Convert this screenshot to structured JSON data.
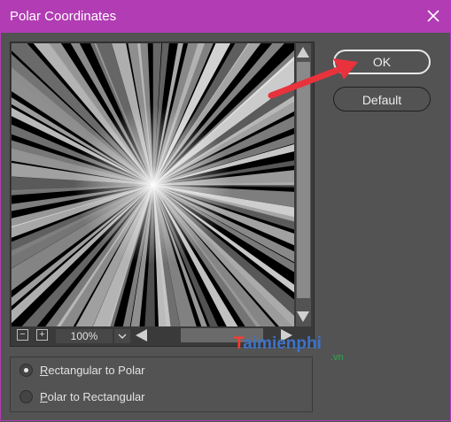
{
  "window": {
    "title": "Polar Coordinates",
    "close_icon": "close-icon",
    "accent_color": "#b23cb4"
  },
  "preview": {
    "zoom_value": "100%",
    "zoom_out_label": "−",
    "zoom_in_label": "+"
  },
  "options": {
    "items": [
      {
        "accel": "R",
        "rest": "ectangular to Polar",
        "checked": true
      },
      {
        "accel": "P",
        "rest": "olar to Rectangular",
        "checked": false
      }
    ]
  },
  "buttons": {
    "ok_label": "OK",
    "default_label": "Default"
  },
  "overlay": {
    "annotation_arrow_color": "#e8323c",
    "watermark_logo_letter": "T",
    "watermark_text": "aimienphi",
    "watermark_suffix": ".vn"
  }
}
